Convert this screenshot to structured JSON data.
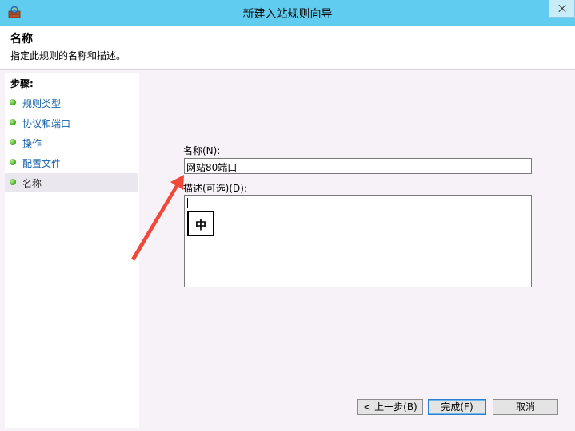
{
  "window": {
    "title": "新建入站规则向导"
  },
  "header": {
    "title": "名称",
    "description": "指定此规则的名称和描述。"
  },
  "steps": {
    "title": "步骤:",
    "items": [
      {
        "label": "规则类型",
        "current": false
      },
      {
        "label": "协议和端口",
        "current": false
      },
      {
        "label": "操作",
        "current": false
      },
      {
        "label": "配置文件",
        "current": false
      },
      {
        "label": "名称",
        "current": true
      }
    ]
  },
  "form": {
    "name_label": "名称(N):",
    "name_value": "网站80端口",
    "description_label": "描述(可选)(D):",
    "description_value": "",
    "ime_indicator": "中"
  },
  "buttons": {
    "back": "< 上一步(B)",
    "finish": "完成(F)",
    "cancel": "取消"
  },
  "colors": {
    "titlebar": "#60cdf0",
    "annotation_arrow": "#f0493a",
    "step_dot": "#3aa322"
  }
}
